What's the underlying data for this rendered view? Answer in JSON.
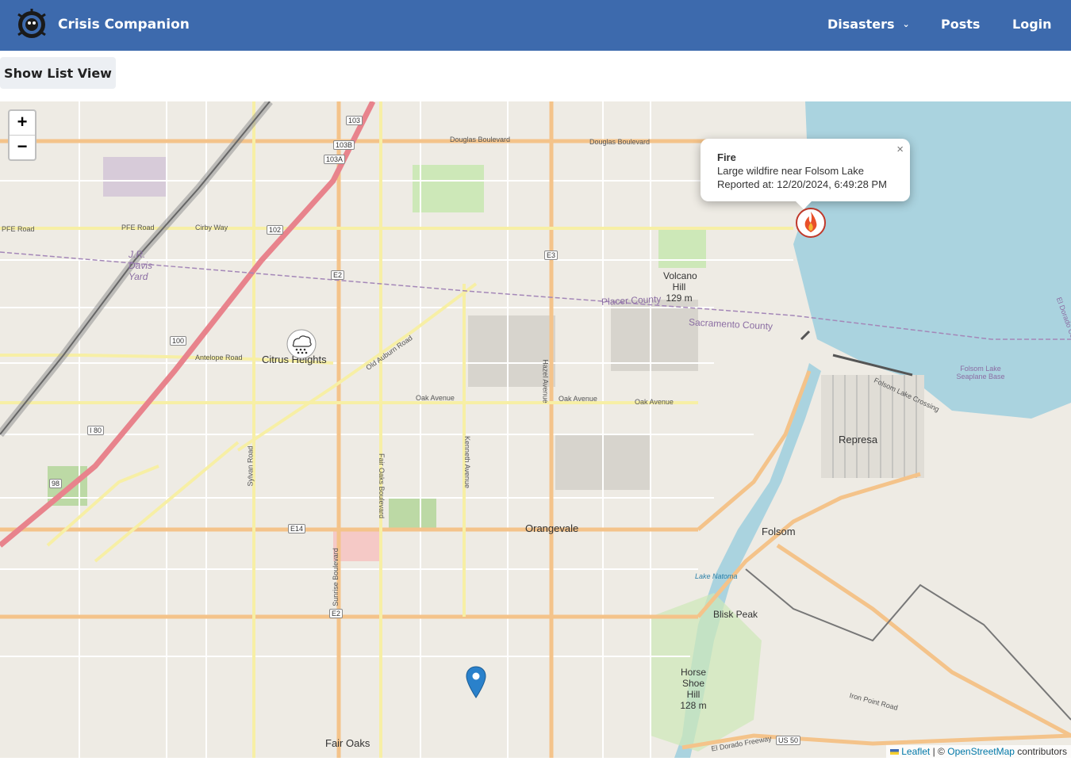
{
  "navbar": {
    "brand": "Crisis Companion",
    "items": [
      {
        "label": "Disasters"
      },
      {
        "label": "Posts"
      },
      {
        "label": "Login"
      }
    ],
    "color": "#3d6aad"
  },
  "list_button": "Show List View",
  "map": {
    "zoom_in": "+",
    "zoom_out": "−",
    "popup": {
      "title": "Fire",
      "description": "Large wildfire near Folsom Lake",
      "reported": "Reported at: 12/20/2024, 6:49:28 PM",
      "close": "×"
    },
    "attribution": {
      "leaflet": "Leaflet",
      "sep": "| ©",
      "osm": "OpenStreetMap",
      "contrib": "contributors"
    },
    "places": {
      "citrus_heights": "Citrus Heights",
      "orangevale": "Orangevale",
      "folsom": "Folsom",
      "represa": "Represa",
      "fair_oaks": "Fair Oaks",
      "volcano_hill": "Volcano Hill",
      "volcano_elev": "129 m",
      "horse_shoe": "Horse Shoe Hill",
      "horse_elev": "128 m",
      "blisk": "Blisk Peak",
      "placer": "Placer County",
      "sacramento": "Sacramento County",
      "seaplane": "Folsom Lake Seaplane Base",
      "jr_davis": "J.R. Davis Yard",
      "lake_natoma": "Lake Natoma",
      "el_dorado": "El Dorado Cou"
    },
    "streets": {
      "douglas": "Douglas Boulevard",
      "pfe": "PFE Road",
      "cirby": "Cirby Way",
      "antelope": "Antelope Road",
      "oak_ave": "Oak Avenue",
      "old_auburn": "Old Auburn Road",
      "hazel": "Hazel Avenue",
      "kenneth": "Kenneth Avenue",
      "sunrise": "Sunrise Boulevard",
      "fair_oaks_blvd": "Fair Oaks Boulevard",
      "sylvan": "Sylvan Road",
      "folsom_lake_crossing": "Folsom Lake Crossing",
      "el_dorado_fwy": "El Dorado Freeway",
      "iron_point": "Iron Point Road"
    },
    "shields": [
      "103",
      "103B",
      "103A",
      "102",
      "E3",
      "E2",
      "100",
      "I 80",
      "98",
      "E14",
      "E2",
      "US 50"
    ],
    "markers": [
      {
        "type": "fire",
        "icon": "fire-icon",
        "color": "#d9442b"
      },
      {
        "type": "hail",
        "icon": "hail-cloud-icon"
      },
      {
        "type": "pin",
        "icon": "map-pin-icon",
        "color": "#2a81cb"
      }
    ]
  }
}
